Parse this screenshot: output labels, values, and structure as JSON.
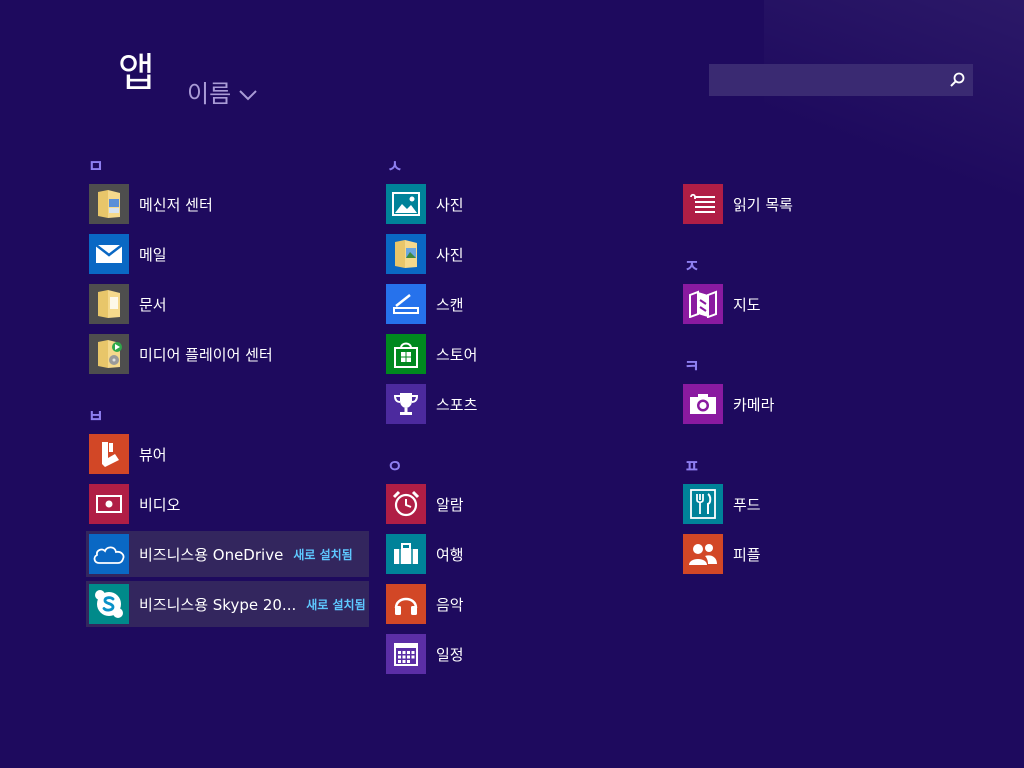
{
  "header": {
    "title": "앱",
    "sort_label": "이름",
    "search": {
      "value": "",
      "placeholder": ""
    }
  },
  "groups": {
    "mieum": "ㅁ",
    "bieup": "ㅂ",
    "siot": "ㅅ",
    "ieung": "ㅇ",
    "jieut": "ㅈ",
    "kieuk": "ㅋ",
    "pieup": "ㅍ"
  },
  "apps": {
    "messenger_center": {
      "label": "메신저 센터",
      "icon": "folder-icon",
      "color": "#4e4e4e"
    },
    "mail": {
      "label": "메일",
      "icon": "mail-icon",
      "color": "#0a68c4"
    },
    "documents": {
      "label": "문서",
      "icon": "folder-icon",
      "color": "#4e4e4e"
    },
    "media_player_center": {
      "label": "미디어 플레이어 센터",
      "icon": "folder-icon",
      "color": "#4e4e4e"
    },
    "viewer": {
      "label": "뷰어",
      "icon": "reader-icon",
      "color": "#d24726"
    },
    "video": {
      "label": "비디오",
      "icon": "video-icon",
      "color": "#b01e45"
    },
    "onedrive_business": {
      "label": "비즈니스용 OneDrive",
      "badge": "새로 설치됨",
      "icon": "cloud-icon",
      "color": "#0a68c4"
    },
    "skype_business": {
      "label": "비즈니스용 Skype 20...",
      "badge": "새로 설치됨",
      "icon": "skype-icon",
      "color": "#008a8a"
    },
    "photos_app": {
      "label": "사진",
      "icon": "photo-icon",
      "color": "#008299"
    },
    "photos_folder": {
      "label": "사진",
      "icon": "folder-icon",
      "color": "#0a68c4"
    },
    "scan": {
      "label": "스캔",
      "icon": "scan-icon",
      "color": "#2672ec"
    },
    "store": {
      "label": "스토어",
      "icon": "store-icon",
      "color": "#00891f"
    },
    "sports": {
      "label": "스포츠",
      "icon": "trophy-icon",
      "color": "#4c2a9e"
    },
    "alarms": {
      "label": "알람",
      "icon": "alarm-icon",
      "color": "#b01e45"
    },
    "travel": {
      "label": "여행",
      "icon": "suitcase-icon",
      "color": "#008299"
    },
    "music": {
      "label": "음악",
      "icon": "headphones-icon",
      "color": "#d24726"
    },
    "calendar": {
      "label": "일정",
      "icon": "calendar-icon",
      "color": "#5b2ea6"
    },
    "reading_list": {
      "label": "읽기 목록",
      "icon": "reading-list-icon",
      "color": "#b01e45"
    },
    "maps": {
      "label": "지도",
      "icon": "map-icon",
      "color": "#8a1aa0"
    },
    "camera": {
      "label": "카메라",
      "icon": "camera-icon",
      "color": "#8a1aa0"
    },
    "food": {
      "label": "푸드",
      "icon": "food-icon",
      "color": "#008299"
    },
    "people": {
      "label": "피플",
      "icon": "people-icon",
      "color": "#d24726"
    }
  }
}
